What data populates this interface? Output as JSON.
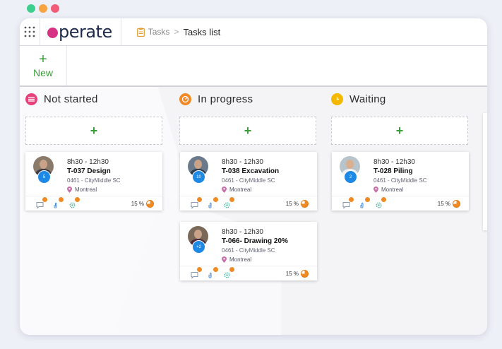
{
  "window_dots": [
    "#3ecf8e",
    "#f7a440",
    "#f25c79"
  ],
  "app": {
    "logo_text": "perate"
  },
  "breadcrumb": {
    "root": "Tasks",
    "separator": ">",
    "current": "Tasks list"
  },
  "toolbar": {
    "new_label": "New",
    "new_icon": "+"
  },
  "add_icon": "+",
  "columns": [
    {
      "title": "Not started",
      "icon": "list-icon",
      "color": "#e8407a"
    },
    {
      "title": "In progress",
      "icon": "progress-icon",
      "color": "#f08a24"
    },
    {
      "title": "Waiting",
      "icon": "clock-icon",
      "color": "#f5b800"
    }
  ],
  "cards": [
    {
      "column": 0,
      "time": "8h30 - 12h30",
      "title": "T-037 Design",
      "code": "0461 - CityMiddle SC",
      "location": "Montreal",
      "count": "5",
      "percent": "15 %"
    },
    {
      "column": 1,
      "time": "8h30 - 12h30",
      "title": "T-038 Excavation",
      "code": "0461 - CityMiddle SC",
      "location": "Montreal",
      "count": "10",
      "percent": "15 %"
    },
    {
      "column": 2,
      "time": "8h30 - 12h30",
      "title": "T-028 Piling",
      "code": "0461 - CityMiddle SC",
      "location": "Montreal",
      "count": "2",
      "percent": "15 %"
    },
    {
      "column": 1,
      "time": "8h30 - 12h30",
      "title": "T-066- Drawing  20%",
      "code": "0461 - CityMiddle SC",
      "location": "Montreal",
      "count": "+2",
      "percent": "15 %"
    }
  ]
}
